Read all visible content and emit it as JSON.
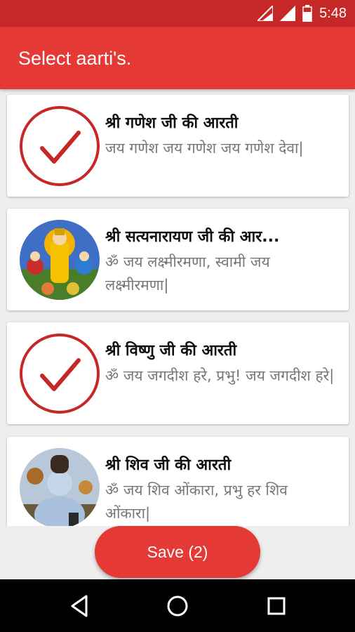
{
  "status": {
    "time": "5:48"
  },
  "appbar": {
    "title": "Select aarti's."
  },
  "items": [
    {
      "title": "श्री गणेश जी की आरती",
      "subtitle": "जय गणेश जय गणेश जय गणेश देवा|",
      "selected": true,
      "icon": "check-icon"
    },
    {
      "title": "श्री सत्यनारायण जी की आर...",
      "subtitle": "ॐ जय लक्ष्मीरमणा, स्वामी जय लक्ष्मीरमणा|",
      "selected": false,
      "icon": "satyanarayan-image"
    },
    {
      "title": "श्री विष्णु जी की आरती",
      "subtitle": "ॐ जय जगदीश हरे, प्रभु! जय जगदीश हरे|",
      "selected": true,
      "icon": "check-icon"
    },
    {
      "title": "श्री शिव जी की आरती",
      "subtitle": "ॐ जय शिव ओंकारा, प्रभु हर शिव ओंकारा|",
      "selected": false,
      "icon": "shiva-image"
    }
  ],
  "save": {
    "label": "Save (2)"
  },
  "colors": {
    "primary": "#e53935",
    "primary_dark": "#c62828",
    "check": "#c62828"
  }
}
